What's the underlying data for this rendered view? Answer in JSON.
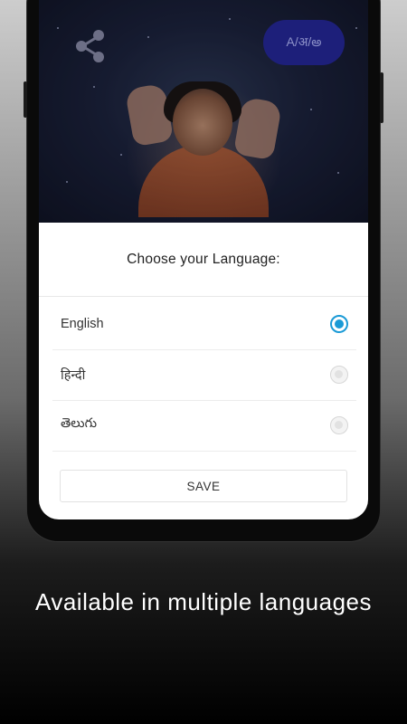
{
  "header": {
    "language_toggle_label": "A/अ/అ"
  },
  "dialog": {
    "title": "Choose your Language:",
    "options": [
      {
        "label": "English",
        "selected": true
      },
      {
        "label": "हिन्दी",
        "selected": false
      },
      {
        "label": "తెలుగు",
        "selected": false
      }
    ],
    "save_label": "SAVE"
  },
  "caption": "Available in multiple languages",
  "colors": {
    "accent": "#1a9ad6",
    "toggle_bg": "#1d1f7a"
  },
  "icons": {
    "share": "share-icon"
  }
}
